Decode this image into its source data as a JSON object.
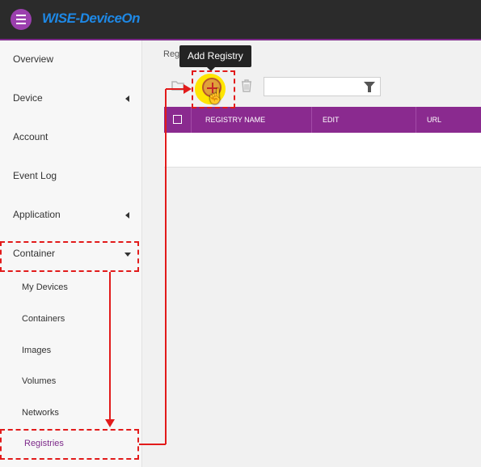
{
  "topbar": {
    "brand": "WISE-DeviceOn",
    "menu_icon": "hamburger-menu-icon"
  },
  "sidebar": {
    "items": [
      {
        "label": "Overview"
      },
      {
        "label": "Device"
      },
      {
        "label": "Account"
      },
      {
        "label": "Event Log"
      },
      {
        "label": "Application"
      },
      {
        "label": "Container"
      }
    ],
    "container_subitems": [
      {
        "label": "My Devices"
      },
      {
        "label": "Containers"
      },
      {
        "label": "Images"
      },
      {
        "label": "Volumes"
      },
      {
        "label": "Networks"
      },
      {
        "label": "Registries"
      }
    ]
  },
  "main": {
    "breadcrumb": "Reg",
    "tooltip": "Add Registry",
    "toolbar_icons": [
      "folder-icon",
      "add-icon",
      "trash-icon",
      "filter-icon"
    ],
    "filter": {
      "value": "",
      "placeholder": ""
    },
    "table": {
      "columns": [
        "REGISTRY NAME",
        "EDIT",
        "URL"
      ],
      "rows": []
    }
  },
  "colors": {
    "topbar_bg": "#2b2b2b",
    "accent_purple": "#8a2a8f",
    "brand_blue": "#1e88e5",
    "annotation_red": "#e21b1b",
    "highlight_yellow": "#ffe500"
  }
}
